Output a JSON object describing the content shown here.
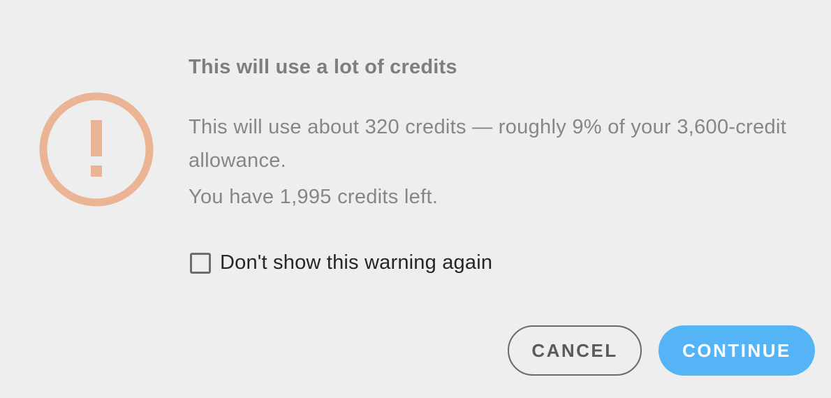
{
  "dialog": {
    "icon": "warning-circle-icon",
    "icon_color": "#ebb495",
    "title": "This will use a lot of credits",
    "message": "This will use about 320 credits — roughly 9% of your 3,600-credit allowance.",
    "remaining": "You have 1,995 credits left.",
    "checkbox": {
      "label": "Don't show this warning again",
      "checked": false
    },
    "buttons": {
      "cancel_label": "CANCEL",
      "continue_label": "CONTINUE",
      "continue_color": "#55b4f5"
    }
  }
}
